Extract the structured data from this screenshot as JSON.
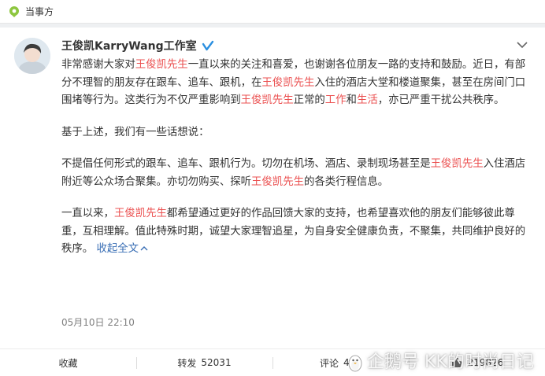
{
  "topbar": {
    "title": "当事方",
    "icon": "location-pin-icon",
    "accent": "#8dc63f"
  },
  "post": {
    "author": "王俊凯KarryWang工作室",
    "verified_icon": "verified-badge-icon",
    "menu_icon": "chevron-down-icon",
    "p1": {
      "a": "非常感谢大家对",
      "b": "王俊凯先生",
      "c": "一直以来的关注和喜爱，也谢谢各位朋友一路的支持和鼓励。近日，有部分不理智的朋友存在跟车、追车、跟机，在",
      "d": "王俊凯先生",
      "e": "入住的酒店大堂和楼道聚集，甚至在房间门口围堵等行为。这类行为不仅严重影响到",
      "f": "王俊凯先生",
      "g": "正常的",
      "h": "工作",
      "i": "和",
      "j": "生活",
      "k": "，亦已严重干扰公共秩序。"
    },
    "p2": "基于上述，我们有一些话想说：",
    "p3": {
      "a": "不提倡任何形式的跟车、追车、跟机行为。切勿在机场、酒店、录制现场甚至是",
      "b": "王俊凯先生",
      "c": "入住酒店附近等公众场合聚集。亦切勿购买、探听",
      "d": "王俊凯先生",
      "e": "的各类行程信息。"
    },
    "p4": {
      "a": "一直以来，",
      "b": "王俊凯先生",
      "c": "都希望通过更好的作品回馈大家的支持，也希望喜欢他的朋友们能够彼此尊重，互相理解。值此特殊时期，诚望大家理智追星，为自身安全健康负责，不聚集，共同维护良好的秩序。"
    },
    "collapse_label": "收起全文",
    "collapse_icon": "caret-up-icon",
    "timestamp": "05月10日 22:10",
    "highlight_color": "#eb5050",
    "link_color": "#3a6fb5"
  },
  "actions": {
    "favorite_label": "收藏",
    "repost_label": "转发",
    "repost_count": "52031",
    "comment_label": "评论",
    "comment_count": "466",
    "like_icon": "thumbs-up-icon",
    "like_count": "219826"
  },
  "watermark": {
    "text": "企鹅号 KK的时尚日记",
    "icon": "penguin-icon"
  }
}
